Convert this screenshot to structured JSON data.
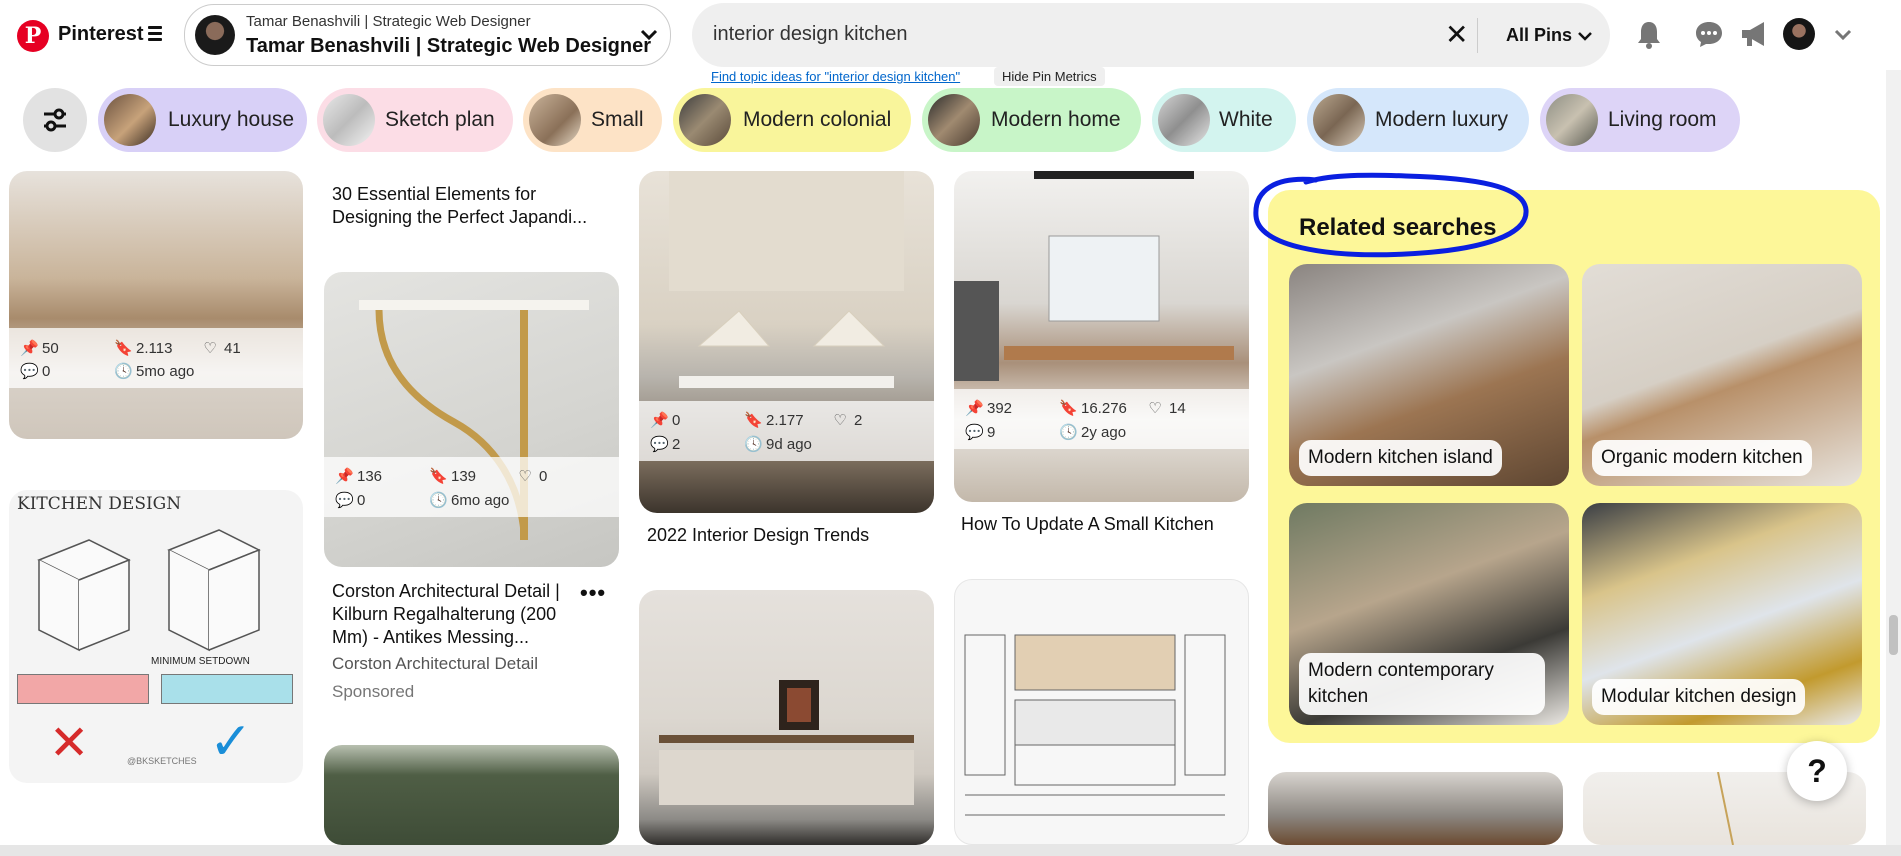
{
  "header": {
    "brand": "Pinterest",
    "account_small": "Tamar Benashvili | Strategic Web Designer",
    "account_big": "Tamar Benashvili | Strategic Web Designer",
    "search_query": "interior design kitchen",
    "filter_label": "All Pins",
    "find_topics_link": "Find topic ideas for \"interior design kitchen\"",
    "hide_metrics_label": "Hide Pin Metrics"
  },
  "chips": [
    {
      "label": "Luxury house",
      "color": "#d8d0f7"
    },
    {
      "label": "Sketch plan",
      "color": "#fcdde6"
    },
    {
      "label": "Small",
      "color": "#fde3c6"
    },
    {
      "label": "Modern colonial",
      "color": "#f9f59b"
    },
    {
      "label": "Modern home",
      "color": "#c8f5c8"
    },
    {
      "label": "White",
      "color": "#d3f4ef"
    },
    {
      "label": "Modern luxury",
      "color": "#d5e7fb"
    },
    {
      "label": "Living room",
      "color": "#ddd4f7"
    }
  ],
  "pins": {
    "p1": {
      "saves_a": "50",
      "saves_b": "2.113",
      "likes": "41",
      "comments": "0",
      "age": "5mo ago"
    },
    "p2": {
      "title": "30 Essential Elements for Designing the Perfect Japandi..."
    },
    "p3": {
      "saves_a": "136",
      "saves_b": "139",
      "likes": "0",
      "comments": "0",
      "age": "6mo ago",
      "title": "Corston Architectural Detail | Kilburn Regalhalterung (200 Mm) - Antikes Messing...",
      "source": "Corston Architectural Detail",
      "sponsored": "Sponsored"
    },
    "p4": {
      "saves_a": "0",
      "saves_b": "2.177",
      "likes": "2",
      "comments": "2",
      "age": "9d ago",
      "title": "2022 Interior Design Trends"
    },
    "p5": {
      "saves_a": "392",
      "saves_b": "16.276",
      "likes": "14",
      "comments": "9",
      "age": "2y ago",
      "title": "How To Update A Small Kitchen"
    },
    "kitchen_design_text": "KITCHEN DESIGN",
    "minimum_setdown_text": "MINIMUM SETDOWN",
    "sketch_credit": "@BKSKETCHES"
  },
  "related": {
    "title": "Related searches",
    "items": [
      {
        "label": "Modern kitchen island"
      },
      {
        "label": "Organic modern kitchen"
      },
      {
        "label": "Modern contemporary kitchen"
      },
      {
        "label": "Modular kitchen design"
      }
    ]
  },
  "help_label": "?",
  "colors": {
    "brand": "#e60023",
    "related_bg": "#fdf799",
    "annotation": "#0a1fe0"
  }
}
